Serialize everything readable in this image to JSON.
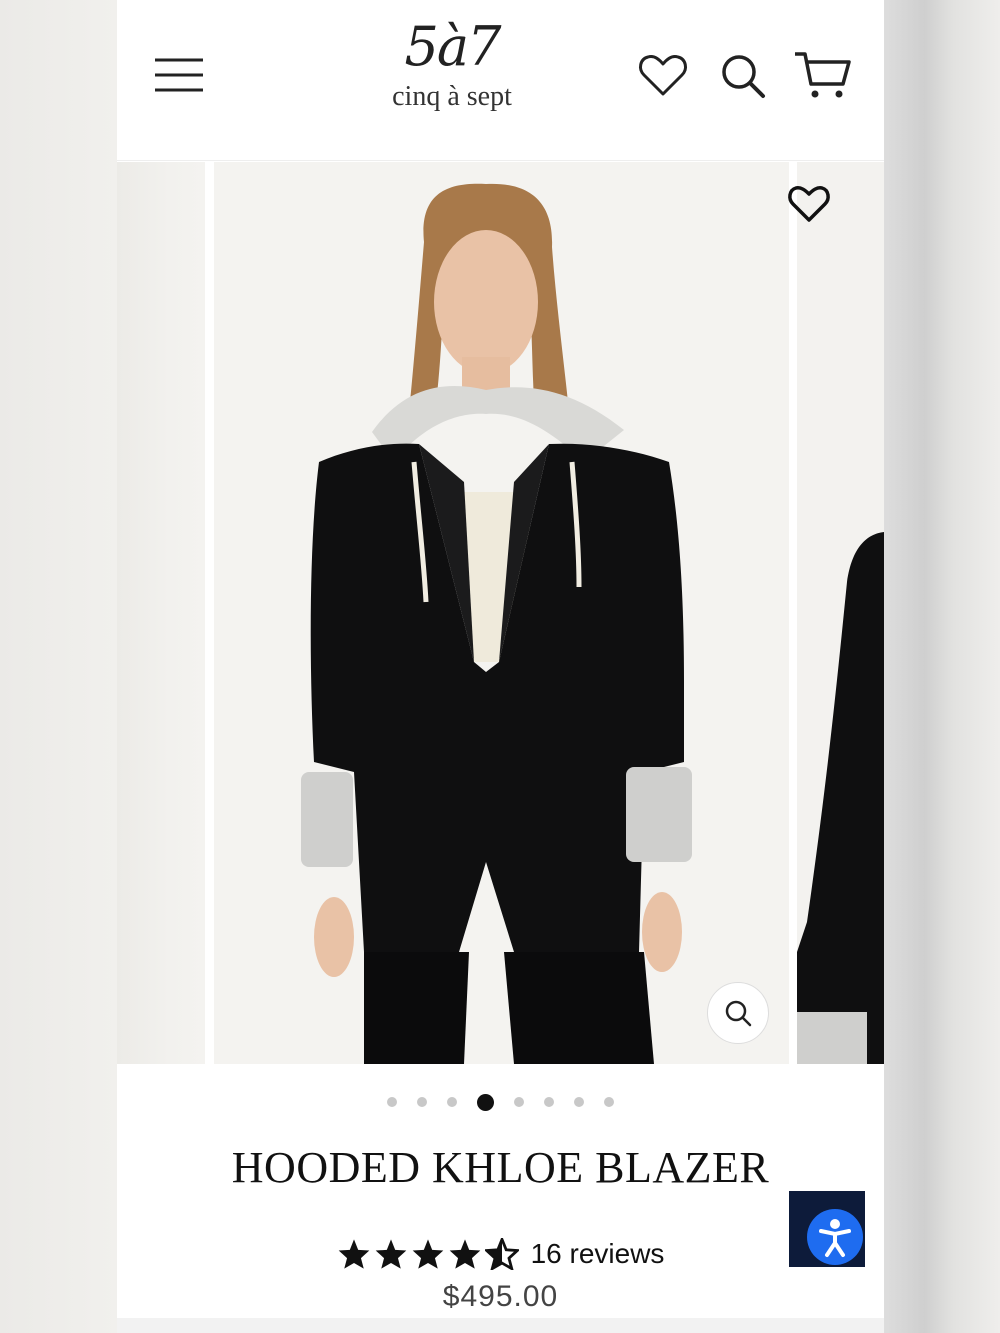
{
  "header": {
    "logo_mark": "5à7",
    "logo_sub": "cinq à sept"
  },
  "gallery": {
    "dot_count": 8,
    "active_dot": 4
  },
  "product": {
    "title": "HOODED KHLOE BLAZER",
    "rating": 4.5,
    "reviews": "16 reviews",
    "price": "$495.00"
  },
  "colors": {
    "text": "#111111",
    "accent_a11y": "#1e6cf0",
    "a11y_bg": "#0d1b3a"
  },
  "icons": [
    "menu-icon",
    "heart-icon",
    "search-icon",
    "cart-icon",
    "zoom-icon",
    "star-icon",
    "accessibility-icon"
  ]
}
